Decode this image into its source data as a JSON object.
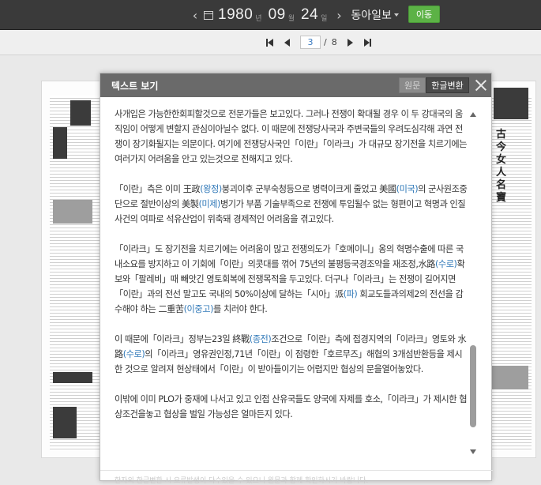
{
  "datebar": {
    "year": "1980",
    "year_unit": "년",
    "month": "09",
    "month_unit": "월",
    "day": "24",
    "day_unit": "일",
    "paper": "동아일보",
    "go_label": "이동"
  },
  "pager": {
    "current": "3",
    "separator": "/",
    "total": "8"
  },
  "newspaper": {
    "side_title": "古今女人名寶"
  },
  "modal": {
    "title": "텍스트 보기",
    "toggle_original": "원문",
    "toggle_hangul": "한글변환",
    "paragraphs": [
      [
        {
          "t": "사개입은 가능한한회피할것으로 전문가들은 보고있다. 그러나 전쟁이 확대될 경우 이 두 강대국의 움직임이 어떻게 변할지 관심이아닐수 없다. 이 때문에 전쟁당사국과 주변국들의 우려도심각해 과연 전쟁이 장기화될지는 의문이다. 여기에 전쟁당사국인「이란」「이라크」가 대규모 장기전을 치르기에는 여러가지 어려움을 안고 있는것으로 전해지고 있다."
        }
      ],
      [
        {
          "t": "「이란」측은 이미 王政"
        },
        {
          "t": "(왕정)",
          "h": true
        },
        {
          "t": "붕괴이후 군부숙청등으로 병력이크게 줄었고 美國"
        },
        {
          "t": "(미국)",
          "h": true
        },
        {
          "t": "의 군사원조중단으로 절반이상의 美製"
        },
        {
          "t": "(미제)",
          "h": true
        },
        {
          "t": "병기가 부품 기술부족으로 전쟁에 투입될수 없는 형편이고 혁명과 인질사건의 여파로 석유산업이 위축돼 경제적인 어려움을 겪고있다."
        }
      ],
      [
        {
          "t": "「이라크」도 장기전을 치르기에는 어려움이 많고 전쟁의도가「호메이니」옹의 혁명수출에 따른 국내소요를 방지하고 이 기회에「이란」의콧대를 꺾어 75년의 불평등국경조약을 재조정,水路"
        },
        {
          "t": "(수로)",
          "h": true
        },
        {
          "t": "확보와「팔레비」때 빼앗긴 영토회복에 전쟁목적을 두고있다. 더구나「이라크」는 전쟁이 길어지면「이란」과의 전선 말고도 국내의 50%이상에 달하는「시아」派"
        },
        {
          "t": "(파)",
          "h": true
        },
        {
          "t": " 회교도들과의제2의 전선을 감수해야 하는 二重苦"
        },
        {
          "t": "(이중고)",
          "h": true
        },
        {
          "t": "를 치러야 한다."
        }
      ],
      [
        {
          "t": "이 때문에「이라크」정부는23일 終戰"
        },
        {
          "t": "(종전)",
          "h": true
        },
        {
          "t": "조건으로「이란」측에 접경지역의「이라크」영토와 水路"
        },
        {
          "t": "(수로)",
          "h": true
        },
        {
          "t": "의「이라크」영유권인정,71년「이란」이 점령한「호르무즈」해협의 3개섬반환등을 제시한 것으로 알려져 현상태에서「이란」이 받아들이기는 어렵지만 협상의 문을열어놓았다."
        }
      ],
      [
        {
          "t": "이밖에 이미 PLO가 중재에 나서고 있고 인접 산유국들도 양국에 자제를 호소,「이라크」가 제시한 협상조건을놓고 협상을 벌일 가능성은 얼마든지 있다."
        }
      ]
    ],
    "footnote": "한자의 한글변환 시 오류발생이 다수있을 수 있으니 원문과 함께 확인하시기 바랍니다."
  },
  "colors": {
    "accent_green": "#5cb246",
    "highlight_blue": "#2f78b8",
    "header_gray": "#6a6a6a"
  }
}
